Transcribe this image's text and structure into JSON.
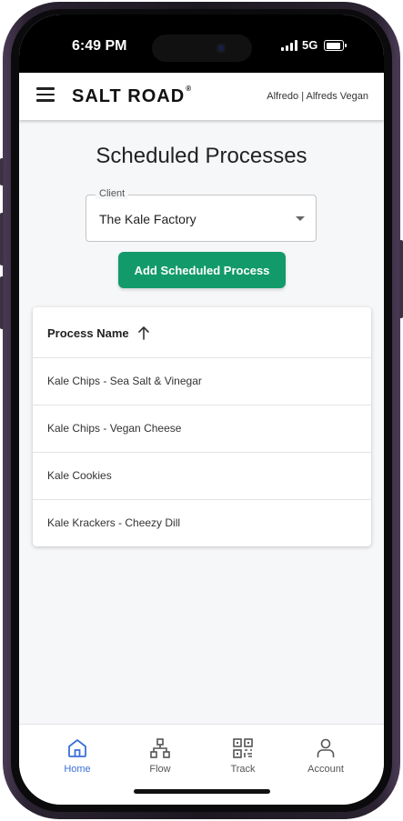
{
  "status_bar": {
    "time": "6:49 PM",
    "network": "5G"
  },
  "app_bar": {
    "logo": "SALT ROAD",
    "logo_mark": "®",
    "user": "Alfredo | Alfreds Vegan"
  },
  "page": {
    "title": "Scheduled Processes"
  },
  "client_select": {
    "label": "Client",
    "value": "The Kale Factory"
  },
  "add_button": {
    "label": "Add Scheduled Process"
  },
  "table": {
    "column": "Process Name",
    "rows": [
      "Kale Chips - Sea Salt & Vinegar",
      "Kale Chips - Vegan Cheese",
      "Kale Cookies",
      "Kale Krackers - Cheezy Dill"
    ]
  },
  "bottom_nav": {
    "items": [
      {
        "label": "Home",
        "icon": "home-icon",
        "active": true
      },
      {
        "label": "Flow",
        "icon": "flow-icon"
      },
      {
        "label": "Track",
        "icon": "qr-code-icon"
      },
      {
        "label": "Account",
        "icon": "person-icon"
      }
    ]
  },
  "colors": {
    "accent": "#139a6b",
    "nav_active": "#3b6fd8"
  }
}
